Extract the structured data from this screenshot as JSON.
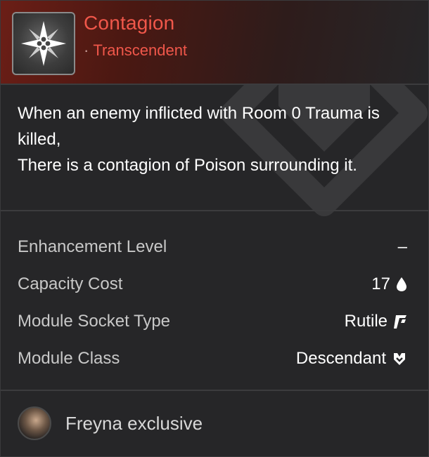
{
  "module": {
    "name": "Contagion",
    "tier": "Transcendent",
    "icon": "module-star-icon"
  },
  "description": {
    "line1": "When an enemy inflicted with Room 0 Trauma is killed,",
    "line2": "There is a contagion of Poison surrounding it."
  },
  "stats": [
    {
      "label": "Enhancement Level",
      "value": "–"
    },
    {
      "label": "Capacity Cost",
      "value": "17",
      "icon": "capacity-drop-icon"
    },
    {
      "label": "Module Socket Type",
      "value": "Rutile",
      "icon": "rutile-socket-icon"
    },
    {
      "label": "Module Class",
      "value": "Descendant",
      "icon": "descendant-class-icon"
    }
  ],
  "footer": {
    "exclusive_text": "Freyna exclusive",
    "avatar": "freyna-portrait"
  },
  "colors": {
    "tier_accent": "#f0574a",
    "background": "#262628",
    "header_gradient_start": "#6b1e16"
  }
}
